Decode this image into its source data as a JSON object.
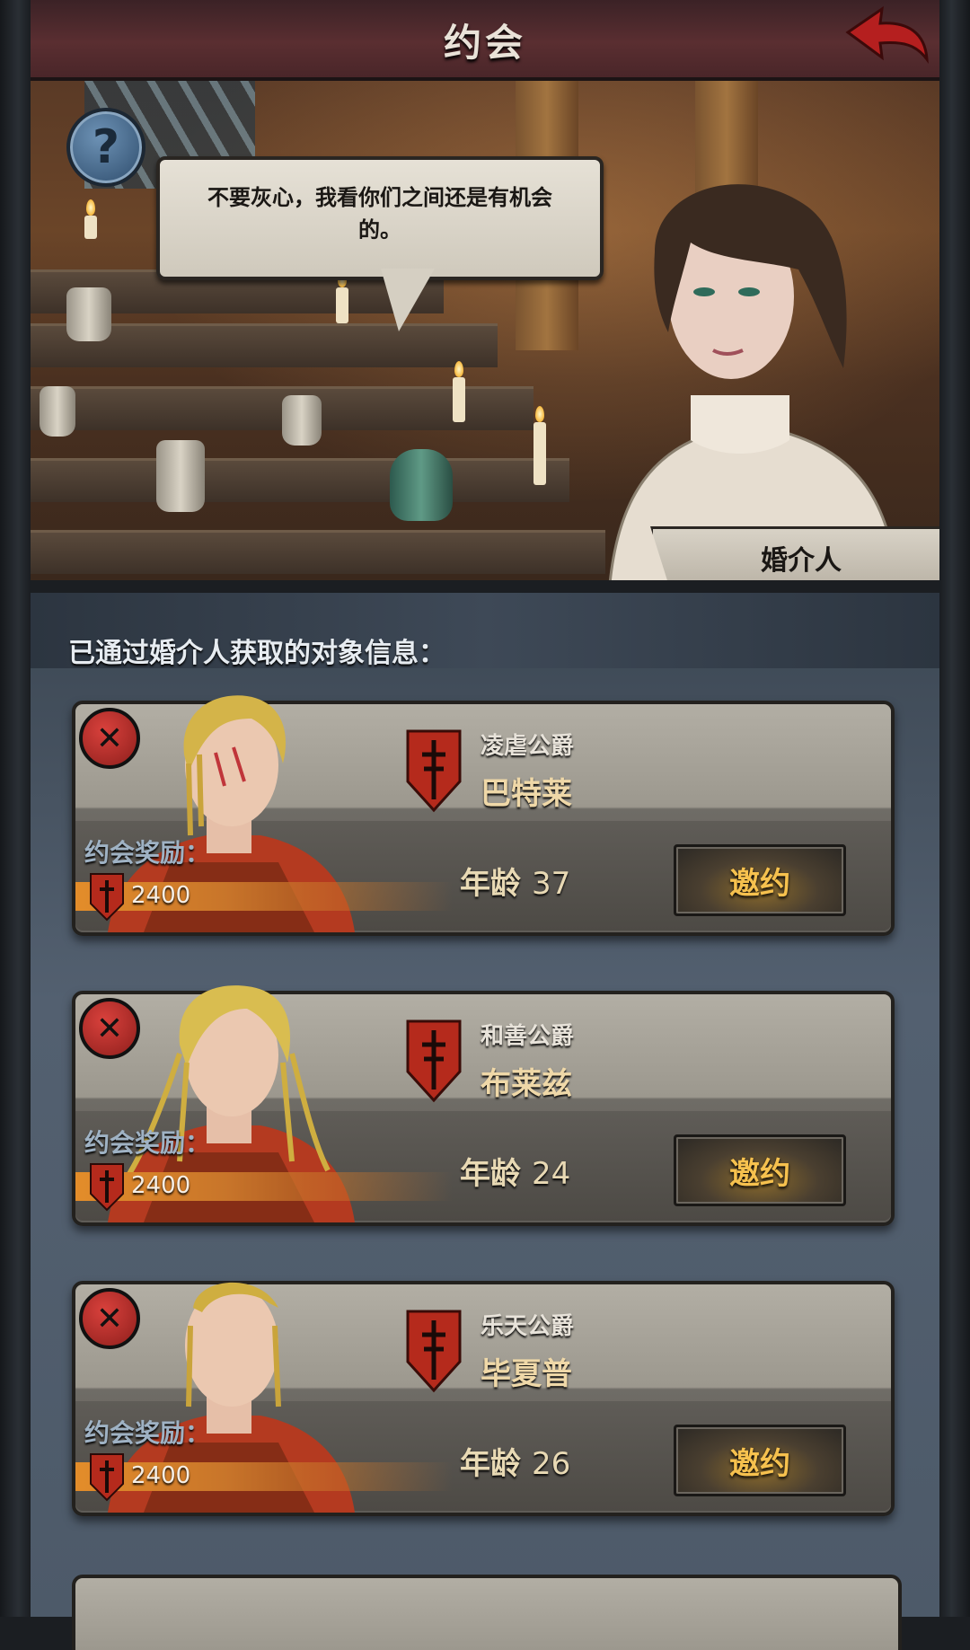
{
  "header": {
    "title": "约会"
  },
  "dialog": {
    "speech": "不要灰心，我看你们之间还是有机会的。",
    "speaker": "婚介人"
  },
  "list": {
    "title": "已通过婚介人获取的对象信息：",
    "reward_label": "约会奖励：",
    "age_label": "年龄",
    "invite_label": "邀约",
    "candidates": [
      {
        "title": "凌虐公爵",
        "name": "巴特莱",
        "age": "37",
        "reward": "2400"
      },
      {
        "title": "和善公爵",
        "name": "布莱兹",
        "age": "24",
        "reward": "2400"
      },
      {
        "title": "乐天公爵",
        "name": "毕夏普",
        "age": "26",
        "reward": "2400"
      }
    ]
  },
  "colors": {
    "accent": "#f6c14e",
    "danger": "#c0322e",
    "header": "#5a2e31"
  }
}
